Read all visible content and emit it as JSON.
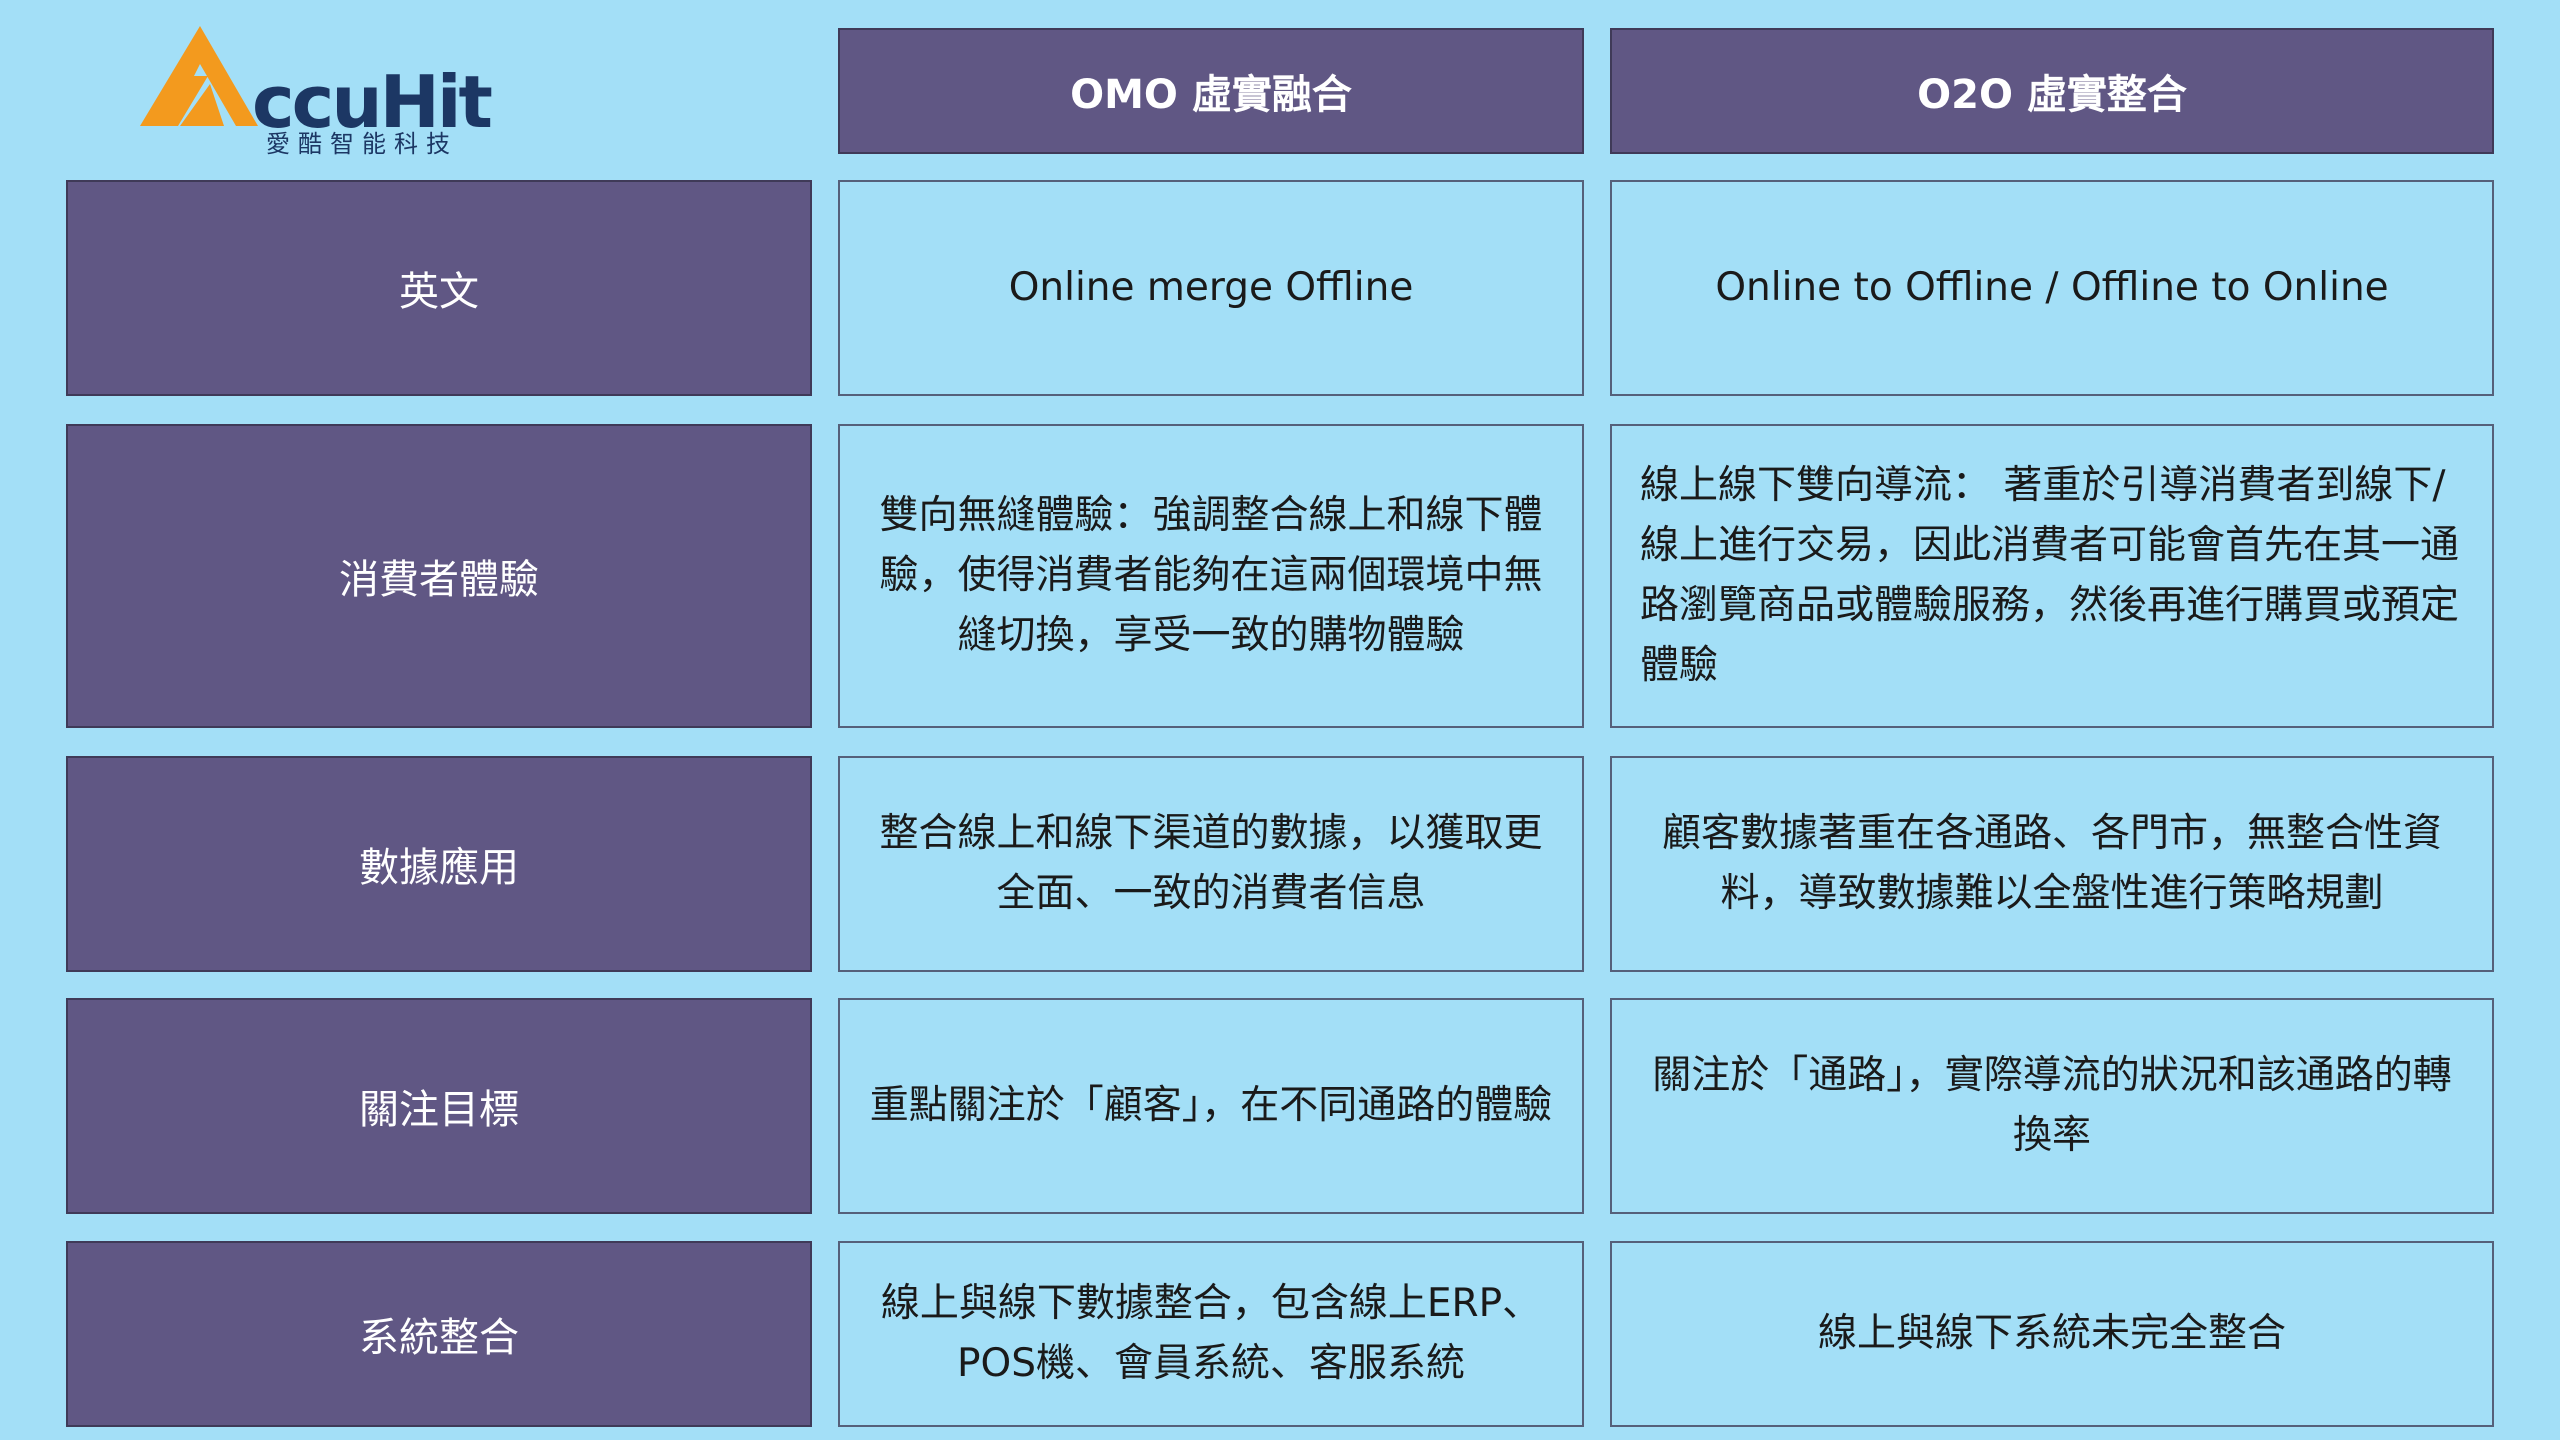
{
  "logo": {
    "wordmark": "ccuHit",
    "subtitle": "愛酷智能科技",
    "colors": {
      "mark": "#f39a1e",
      "text": "#1c3764"
    }
  },
  "columns": [
    "OMO 虛實融合",
    "O2O 虛實整合"
  ],
  "rows": [
    {
      "label": "英文",
      "omo": "Online merge Offline",
      "o2o": "Online to Offline / Offline to Online"
    },
    {
      "label": "消費者體驗",
      "omo": "雙向無縫體驗：強調整合線上和線下體驗，使得消費者能夠在這兩個環境中無縫切換，享受一致的購物體驗",
      "o2o": "線上線下雙向導流： 著重於引導消費者到線下/線上進行交易，因此消費者可能會首先在其一通路瀏覽商品或體驗服務，然後再進行購買或預定體驗"
    },
    {
      "label": "數據應用",
      "omo": "整合線上和線下渠道的數據，以獲取更全面、一致的消費者信息",
      "o2o": "顧客數據著重在各通路、各門市，無整合性資料，導致數據難以全盤性進行策略規劃"
    },
    {
      "label": "關注目標",
      "omo": "重點關注於「顧客」，在不同通路的體驗",
      "o2o": "關注於「通路」，實際導流的狀況和該通路的轉換率"
    },
    {
      "label": "系統整合",
      "omo": "線上與線下數據整合，包含線上ERP、POS機、會員系統、客服系統",
      "o2o": "線上與線下系統未完全整合"
    }
  ],
  "colors": {
    "background": "#a3dff7",
    "header_fill": "#605784",
    "header_text": "#ffffff"
  }
}
